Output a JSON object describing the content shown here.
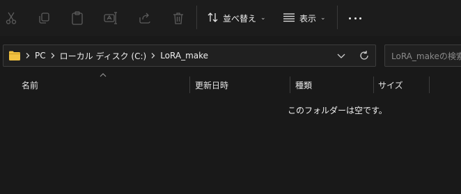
{
  "toolbar": {
    "icons": [
      "cut-icon",
      "copy-icon",
      "paste-icon",
      "rename-icon",
      "share-icon",
      "delete-icon"
    ],
    "sort_label": "並べ替え",
    "view_label": "表示",
    "more_icon": "more-icon"
  },
  "address_bar": {
    "folder_icon": "folder-icon",
    "crumbs": [
      "PC",
      "ローカル ディスク (C:)",
      "LoRA_make"
    ]
  },
  "search": {
    "placeholder": "LoRA_makeの検索"
  },
  "columns": [
    "名前",
    "更新日時",
    "種類",
    "サイズ"
  ],
  "empty_message": "このフォルダーは空です。",
  "colors": {
    "background": "#191919",
    "folder": "#f1c141",
    "disabled_icon": "#5c5c5c",
    "border": "#3d3d3d",
    "text": "#f0f0f0"
  }
}
